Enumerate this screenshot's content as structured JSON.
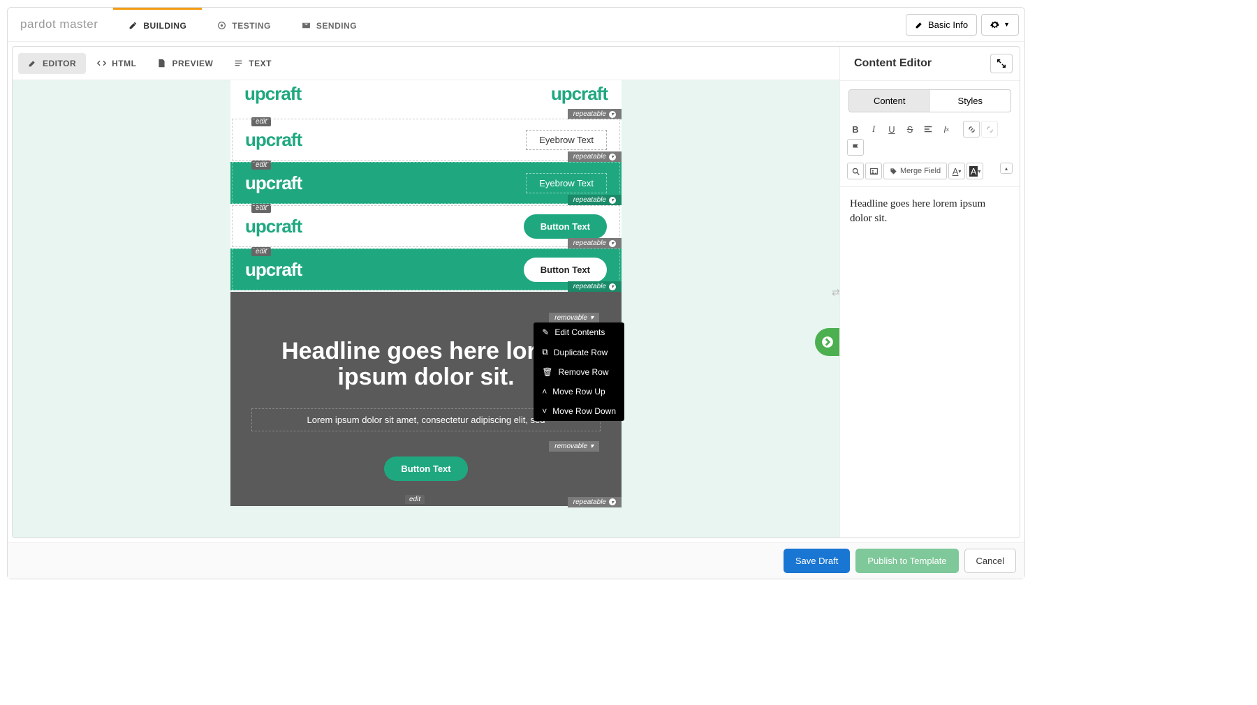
{
  "brand": "pardot master",
  "nav": {
    "building": "BUILDING",
    "testing": "TESTING",
    "sending": "SENDING"
  },
  "basic_info": "Basic Info",
  "tools": {
    "editor": "EDITOR",
    "html": "HTML",
    "preview": "PREVIEW",
    "text": "TEXT"
  },
  "tags": {
    "edit": "edit",
    "repeatable": "repeatable",
    "removable": "removable"
  },
  "blocks": {
    "logo": "upcraft",
    "eyebrow": "Eyebrow Text",
    "button": "Button Text",
    "headline": "Headline goes here lorem ipsum dolor sit.",
    "body": "Lorem ipsum dolor sit amet, consectetur adipiscing elit, sed"
  },
  "context": {
    "edit": "Edit Contents",
    "dup": "Duplicate Row",
    "remove": "Remove Row",
    "up": "Move Row Up",
    "down": "Move Row Down"
  },
  "panel": {
    "title": "Content Editor",
    "content_tab": "Content",
    "styles_tab": "Styles",
    "merge_field": "Merge Field",
    "body": "Headline goes here lorem ipsum dolor sit."
  },
  "footer": {
    "save": "Save Draft",
    "publish": "Publish to Template",
    "cancel": "Cancel"
  },
  "colors": {
    "accent": "#1fa87f",
    "orange": "#f39c12",
    "primary": "#1976d2",
    "success": "#7fc89a"
  }
}
